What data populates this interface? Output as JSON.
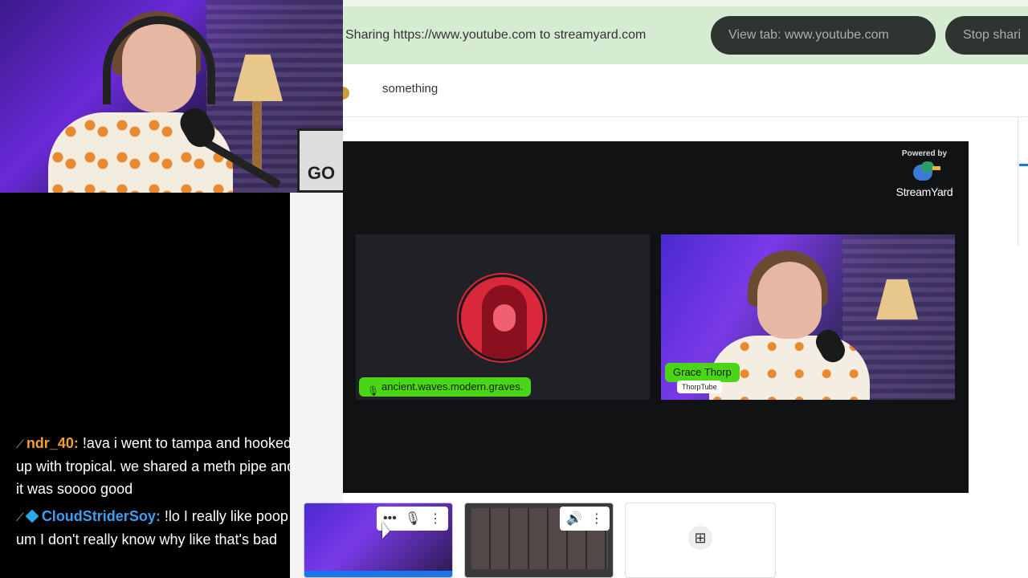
{
  "share_bar": {
    "text": "Sharing https://www.youtube.com to streamyard.com",
    "view_tab_label": "View tab: www.youtube.com",
    "stop_label": "Stop shari"
  },
  "page": {
    "top_word": "something"
  },
  "canvas": {
    "powered_by": "Powered by",
    "brand": "StreamYard",
    "participants": [
      {
        "name": "ancient.waves.modern.graves.",
        "muted": true
      },
      {
        "name": "Grace Thorp",
        "subtitle": "ThorpTube"
      }
    ]
  },
  "webcam": {
    "sign_text": "GO"
  },
  "chat": {
    "messages": [
      {
        "badge": "⟋",
        "user": "ndr_40:",
        "user_color": "#f0a030",
        "text": " !ava i went to tampa and hooked up with tropical. we shared a meth pipe and it was soooo good"
      },
      {
        "badge": "⟋",
        "user": "CloudStriderSoy:",
        "user_color": "#3aa0f0",
        "text": " !lo I really like poop um I don't really know why like that's bad"
      }
    ]
  },
  "icons": {
    "mic": "🎙",
    "speaker": "🔊",
    "more": "⋮",
    "dots": "•••",
    "screen_add": "⊞",
    "muted_mic": "🎙"
  }
}
